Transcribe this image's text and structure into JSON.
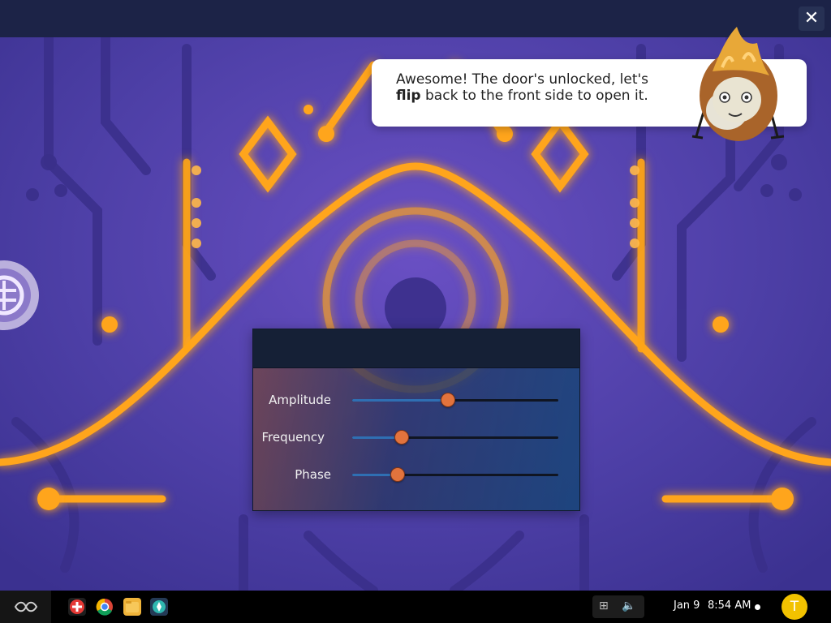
{
  "dialog": {
    "message_pre": "Awesome! The door's unlocked, let's",
    "message_bold": "flip",
    "message_post": " back to the front side to open it.",
    "close_symbol": "✕"
  },
  "controls": [
    {
      "label": "Amplitude",
      "value": 0.465
    },
    {
      "label": "Frequency",
      "value": 0.24
    },
    {
      "label": "Phase",
      "value": 0.22
    }
  ],
  "taskbar": {
    "launcher_icon": "endless-launcher-icon",
    "apps": [
      "add-app-icon",
      "chrome-icon",
      "files-icon",
      "hack-app-icon"
    ],
    "tray_icons": [
      "network-icon",
      "volume-icon"
    ],
    "date": "Jan 9",
    "time": "8:54 AM",
    "avatar_letter": "T"
  },
  "colors": {
    "background": "#5546b0",
    "glow": "#ffa51a",
    "thumb": "#e2733d",
    "avatar": "#f2c200"
  }
}
